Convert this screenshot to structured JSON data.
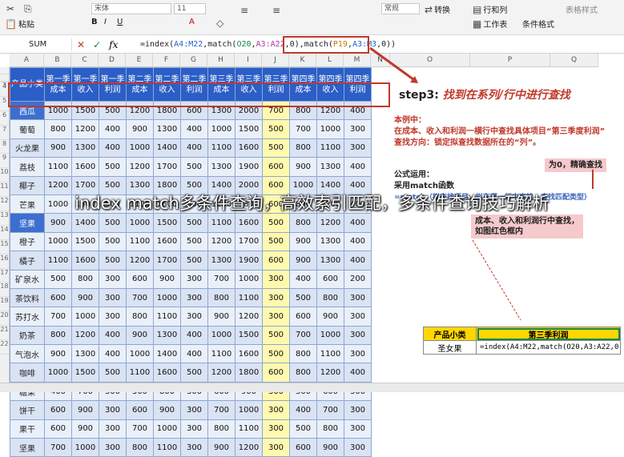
{
  "ribbon": {
    "paste": "粘贴",
    "font_name": "宋体",
    "font_size": "11",
    "number_format": "常规",
    "convert": "转换",
    "rows_cols": "行和列",
    "worksheet": "工作表",
    "cond_format": "条件格式",
    "cell_style": "表格样式"
  },
  "formula_bar": {
    "name_box": "SUM",
    "fx": "fx",
    "formula_prefix": "=index(",
    "ref1": "A4:M22",
    "mid1": ",match(",
    "ref2": "O20",
    "sep": ",",
    "ref3": "A3:A22",
    "mid2": ",0)",
    "mid3": ",match(",
    "ref4": "P19",
    "ref5": "A3:M3",
    "suffix": ",0))"
  },
  "columns": [
    "A",
    "B",
    "C",
    "D",
    "E",
    "F",
    "G",
    "H",
    "I",
    "J",
    "K",
    "L",
    "M",
    "N",
    "O",
    "P",
    "Q"
  ],
  "rows": [
    "1",
    "2",
    "3",
    "4",
    "5",
    "6",
    "7",
    "8",
    "9",
    "10",
    "11",
    "12",
    "13",
    "14",
    "15",
    "16",
    "17",
    "18",
    "19",
    "20",
    "21",
    "22"
  ],
  "table": {
    "headers": [
      "产品小类",
      "第一季成本",
      "第一季收入",
      "第一季利润",
      "第二季成本",
      "第二季收入",
      "第二季利润",
      "第三季成本",
      "第三季收入",
      "第三季利润",
      "第四季成本",
      "第四季收入",
      "第四季利润"
    ],
    "rows": [
      [
        "西瓜",
        "1000",
        "1500",
        "500",
        "1200",
        "1800",
        "600",
        "1300",
        "2000",
        "700",
        "800",
        "1200",
        "400"
      ],
      [
        "葡萄",
        "800",
        "1200",
        "400",
        "900",
        "1300",
        "400",
        "1000",
        "1500",
        "500",
        "700",
        "1000",
        "300"
      ],
      [
        "火龙果",
        "900",
        "1300",
        "400",
        "1000",
        "1400",
        "400",
        "1100",
        "1600",
        "500",
        "800",
        "1100",
        "300"
      ],
      [
        "荔枝",
        "1100",
        "1600",
        "500",
        "1200",
        "1700",
        "500",
        "1300",
        "1900",
        "600",
        "900",
        "1300",
        "400"
      ],
      [
        "椰子",
        "1200",
        "1700",
        "500",
        "1300",
        "1800",
        "500",
        "1400",
        "2000",
        "600",
        "1000",
        "1400",
        "400"
      ],
      [
        "芒果",
        "1000",
        "1500",
        "500",
        "1100",
        "1600",
        "500",
        "1200",
        "1800",
        "600",
        "800",
        "1200",
        "400"
      ],
      [
        "坚果",
        "900",
        "1400",
        "500",
        "1000",
        "1500",
        "500",
        "1100",
        "1600",
        "500",
        "800",
        "1200",
        "400"
      ],
      [
        "橙子",
        "1000",
        "1500",
        "500",
        "1100",
        "1600",
        "500",
        "1200",
        "1700",
        "500",
        "900",
        "1300",
        "400"
      ],
      [
        "橘子",
        "1100",
        "1600",
        "500",
        "1200",
        "1700",
        "500",
        "1300",
        "1900",
        "600",
        "900",
        "1300",
        "400"
      ],
      [
        "矿泉水",
        "500",
        "800",
        "300",
        "600",
        "900",
        "300",
        "700",
        "1000",
        "300",
        "400",
        "600",
        "200"
      ],
      [
        "茶饮料",
        "600",
        "900",
        "300",
        "700",
        "1000",
        "300",
        "800",
        "1100",
        "300",
        "500",
        "800",
        "300"
      ],
      [
        "苏打水",
        "700",
        "1000",
        "300",
        "800",
        "1100",
        "300",
        "900",
        "1200",
        "300",
        "600",
        "900",
        "300"
      ],
      [
        "奶茶",
        "800",
        "1200",
        "400",
        "900",
        "1300",
        "400",
        "1000",
        "1500",
        "500",
        "700",
        "1000",
        "300"
      ],
      [
        "气泡水",
        "900",
        "1300",
        "400",
        "1000",
        "1400",
        "400",
        "1100",
        "1600",
        "500",
        "800",
        "1100",
        "300"
      ],
      [
        "咖啡",
        "1000",
        "1500",
        "500",
        "1100",
        "1600",
        "500",
        "1200",
        "1800",
        "600",
        "800",
        "1200",
        "400"
      ],
      [
        "糖果",
        "400",
        "700",
        "300",
        "500",
        "800",
        "300",
        "600",
        "900",
        "300",
        "300",
        "600",
        "300"
      ],
      [
        "饼干",
        "600",
        "900",
        "300",
        "600",
        "900",
        "300",
        "700",
        "1000",
        "300",
        "400",
        "700",
        "300"
      ],
      [
        "果干",
        "600",
        "900",
        "300",
        "700",
        "1000",
        "300",
        "800",
        "1100",
        "300",
        "500",
        "800",
        "300"
      ],
      [
        "坚果",
        "700",
        "1000",
        "300",
        "800",
        "1100",
        "300",
        "900",
        "1200",
        "300",
        "600",
        "900",
        "300"
      ]
    ]
  },
  "annotations": {
    "step_label": "step3:",
    "step_desc": "找到在系列/行中进行查找",
    "example_title": "本例中：",
    "example_line1": "在成本、收入和利润一横行中查找具体项目“第三季度利润”",
    "example_line2": "查找方向：锁定拟查找数据所在的“列”。",
    "exact_match": "为0，精确查找",
    "formula_use": "公式运用：",
    "use_match": "采用match函数",
    "match_hint": "=match（拟查找项目，拟在哪一行中查找，查找匹配类型）",
    "note_line1": "成本、收入和利润行中查找，",
    "note_line2": "如图红色框内"
  },
  "bottom": {
    "h1": "产品小类",
    "h2": "第三季利润",
    "v1": "圣女果",
    "v2": "=index(A4:M22,match(O20,A3:A22,0),"
  },
  "overlay_title": "index match多条件查询，高效索引匹配，多条件查询技巧解析"
}
